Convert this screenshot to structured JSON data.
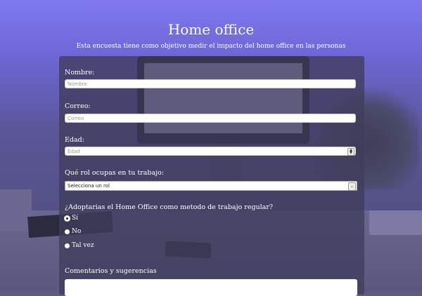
{
  "page": {
    "title": "Home office",
    "subtitle": "Esta encuesta tiene como objetivo medir el impacto del home office en las personas"
  },
  "form": {
    "name": {
      "label": "Nombre:",
      "placeholder": "Nombre"
    },
    "email": {
      "label": "Correo:",
      "placeholder": "Correo"
    },
    "age": {
      "label": "Edad:",
      "placeholder": "Edad"
    },
    "role": {
      "label": "Qué rol ocupas en tu trabajo:",
      "selected": "Selecciona un rol"
    },
    "adopt": {
      "question": "¿Adoptarias el Home Office como metodo de trabajo regular?",
      "options": [
        {
          "label": "Sí",
          "checked": true
        },
        {
          "label": "No",
          "checked": false
        },
        {
          "label": "Tal vez",
          "checked": false
        }
      ]
    },
    "comments": {
      "label": "Comentarios y sugerencias"
    }
  }
}
